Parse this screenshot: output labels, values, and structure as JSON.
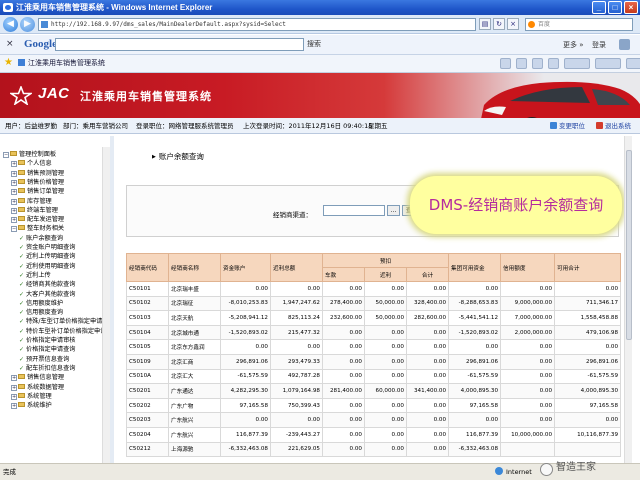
{
  "window": {
    "title": "江淮乘用车销售管理系统 - Windows Internet Explorer"
  },
  "addressbar": {
    "url": "http://192.168.9.97/dms_sales/MainDealerDefault.aspx?sysid=Select",
    "search_placeholder": "百度"
  },
  "google_toolbar": {
    "logo": "Google",
    "search_label": "搜索",
    "more_label": "更多 »",
    "login_label": "登录"
  },
  "favorites_bar": {
    "tab_label": "江淮乘用车销售管理系统"
  },
  "banner": {
    "brand": "JAC",
    "system_title": "江淮乘用车销售管理系统",
    "accent_color": "#c81b24"
  },
  "userbar": {
    "user": "用户：后益维罗勤",
    "department": "部门：乘用车营销公司",
    "login_position": "登录职位：网络管理服系统管理员",
    "last_login": "上次登录时间：2011年12月16日 09:40:15",
    "weekday": "星期五",
    "switch_label": "变更职位",
    "exit_label": "退出系统"
  },
  "sidebar": {
    "items": [
      {
        "label": "管理控制面板",
        "level": 0,
        "kind": "root"
      },
      {
        "label": "个人信息",
        "level": 1,
        "kind": "folder"
      },
      {
        "label": "销售预测管理",
        "level": 1,
        "kind": "folder"
      },
      {
        "label": "销售价格管理",
        "level": 1,
        "kind": "folder"
      },
      {
        "label": "销售订单管理",
        "level": 1,
        "kind": "folder"
      },
      {
        "label": "库存管理",
        "level": 1,
        "kind": "folder"
      },
      {
        "label": "终端车管理",
        "level": 1,
        "kind": "folder"
      },
      {
        "label": "配车发运管理",
        "level": 1,
        "kind": "folder"
      },
      {
        "label": "整车财务相关",
        "level": 1,
        "kind": "folder-open"
      },
      {
        "label": "账户余额查询",
        "level": 2,
        "kind": "leaf"
      },
      {
        "label": "资金账户明细查询",
        "level": 2,
        "kind": "leaf"
      },
      {
        "label": "近利上传明细查询",
        "level": 2,
        "kind": "leaf"
      },
      {
        "label": "近利使用明细查询",
        "level": 2,
        "kind": "leaf"
      },
      {
        "label": "近利上传",
        "level": 2,
        "kind": "leaf"
      },
      {
        "label": "经销商其他款查询",
        "level": 2,
        "kind": "leaf"
      },
      {
        "label": "大客户其他款查询",
        "level": 2,
        "kind": "leaf"
      },
      {
        "label": "信用额度维护",
        "level": 2,
        "kind": "leaf"
      },
      {
        "label": "信用额度查询",
        "level": 2,
        "kind": "leaf"
      },
      {
        "label": "特殊/车型订单价格指定申请",
        "level": 2,
        "kind": "leaf"
      },
      {
        "label": "特价车型补订单价格指定申请",
        "level": 2,
        "kind": "leaf"
      },
      {
        "label": "价格指定申请审核",
        "level": 2,
        "kind": "leaf"
      },
      {
        "label": "价格指定申请查询",
        "level": 2,
        "kind": "leaf"
      },
      {
        "label": "预开票信息查询",
        "level": 2,
        "kind": "leaf"
      },
      {
        "label": "配车折扣信息查询",
        "level": 2,
        "kind": "leaf"
      },
      {
        "label": "销售信息管理",
        "level": 1,
        "kind": "folder"
      },
      {
        "label": "系统数据管理",
        "level": 1,
        "kind": "folder"
      },
      {
        "label": "系统管理",
        "level": 1,
        "kind": "folder"
      },
      {
        "label": "系统维护",
        "level": 1,
        "kind": "folder"
      }
    ]
  },
  "main": {
    "page_title": "账户余额查询",
    "query_label": "经销商渠道：",
    "query_value": "",
    "browse_label": "...",
    "query_button": "查询",
    "overlay_text": "DMS-经销商账户余额查询"
  },
  "table": {
    "group_header": "预扣",
    "headers": {
      "code": "经销商代码",
      "name": "经销商名称",
      "fund": "资金账户",
      "rebate": "近利总额",
      "car": "车款",
      "rebate2": "近利",
      "subtotal": "合计",
      "available": "集团可用资金",
      "credit": "信用额度",
      "total": "可用合计"
    },
    "rows": [
      [
        "C50101",
        "北京瑞丰盛",
        "0.00",
        "0.00",
        "0.00",
        "0.00",
        "0.00",
        "0.00",
        "0.00",
        "0.00"
      ],
      [
        "C50102",
        "北京瑞征",
        "-8,010,253.83",
        "1,947,247.62",
        "278,400.00",
        "50,000.00",
        "328,400.00",
        "-8,288,653.83",
        "9,000,000.00",
        "711,346.17"
      ],
      [
        "C50103",
        "北京天航",
        "-5,208,941.12",
        "825,113.24",
        "232,600.00",
        "50,000.00",
        "282,600.00",
        "-5,441,541.12",
        "7,000,000.00",
        "1,558,458.88"
      ],
      [
        "C50104",
        "北京城市通",
        "-1,520,893.02",
        "215,477.32",
        "0.00",
        "0.00",
        "0.00",
        "-1,520,893.02",
        "2,000,000.00",
        "479,106.98"
      ],
      [
        "C50105",
        "北京东方鑫润",
        "0.00",
        "0.00",
        "0.00",
        "0.00",
        "0.00",
        "0.00",
        "0.00",
        "0.00"
      ],
      [
        "C50109",
        "北京汇商",
        "296,891.06",
        "293,479.33",
        "0.00",
        "0.00",
        "0.00",
        "296,891.06",
        "0.00",
        "296,891.06"
      ],
      [
        "C5010A",
        "北京汇大",
        "-61,575.59",
        "492,787.28",
        "0.00",
        "0.00",
        "0.00",
        "-61,575.59",
        "0.00",
        "-61,575.59"
      ],
      [
        "C50201",
        "广东通达",
        "4,282,295.30",
        "1,079,164.98",
        "281,400.00",
        "60,000.00",
        "341,400.00",
        "4,000,895.30",
        "0.00",
        "4,000,895.30"
      ],
      [
        "C50202",
        "广东广物",
        "97,165.58",
        "750,399.43",
        "0.00",
        "0.00",
        "0.00",
        "97,165.58",
        "0.00",
        "97,165.58"
      ],
      [
        "C50203",
        "广东航兴",
        "0.00",
        "0.00",
        "0.00",
        "0.00",
        "0.00",
        "0.00",
        "0.00",
        "0.00"
      ],
      [
        "C50204",
        "广东航兴",
        "116,877.39",
        "-239,443.27",
        "0.00",
        "0.00",
        "0.00",
        "116,877.39",
        "10,000,000.00",
        "10,116,877.39"
      ],
      [
        "C50212",
        "上海源驰",
        "-6,332,463.08",
        "221,629.05",
        "0.00",
        "0.00",
        "0.00",
        "-6,332,463.08",
        "",
        ""
      ]
    ]
  },
  "statusbar": {
    "status": "完成",
    "zone": "Internet",
    "watermark": "智造王家"
  }
}
